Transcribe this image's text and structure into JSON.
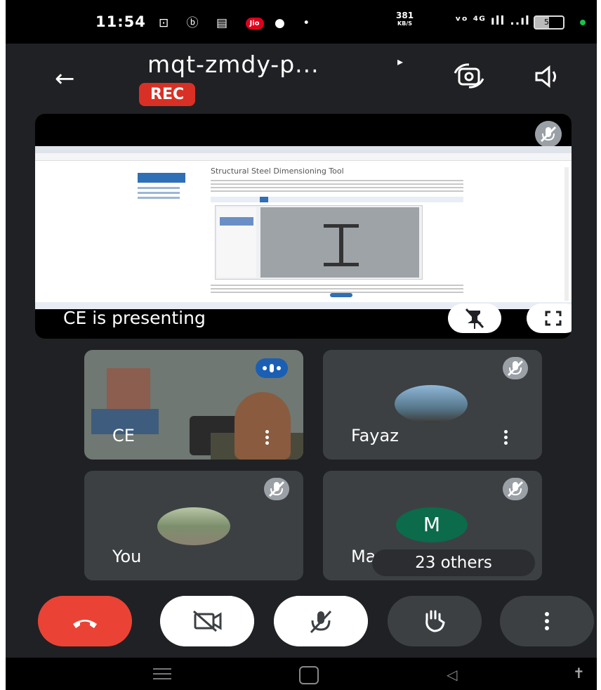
{
  "status_bar": {
    "time": "11:54",
    "left_icons": "⊡ ⓑ ▤",
    "carrier_badge": "Jio",
    "speed_value": "381",
    "speed_unit": "KB/S",
    "signal_text": "ᵛᵒ ⁴ᴳ ıll ..ıl",
    "battery": "50"
  },
  "top_bar": {
    "meeting_code": "mqt-zmdy-p...",
    "recording_badge": "REC",
    "expand_glyph": "▸"
  },
  "presentation": {
    "presenter_label": "CE is presenting",
    "shared_screen_heading": "Structural Steel Dimensioning Tool"
  },
  "participants": [
    {
      "name": "CE"
    },
    {
      "name": "Fayaz"
    },
    {
      "name": "You"
    },
    {
      "name": "Ma",
      "avatar_letter": "M"
    }
  ],
  "others_chip": "23 others",
  "icons": {
    "back": "back-arrow-icon",
    "rotate_camera": "rotate-camera-icon",
    "speaker": "speaker-icon",
    "mic_off": "mic-off-icon",
    "pin_off": "pin-off-icon",
    "fullscreen": "fullscreen-icon",
    "end_call": "end-call-icon",
    "camera_off": "camera-off-icon",
    "raise_hand": "raise-hand-icon",
    "more": "more-vert-icon"
  },
  "colors": {
    "background": "#202124",
    "end_call": "#ea4335",
    "rec": "#d93025",
    "speaking": "#1a5fb4",
    "avatar_m": "#0b6b4a"
  }
}
